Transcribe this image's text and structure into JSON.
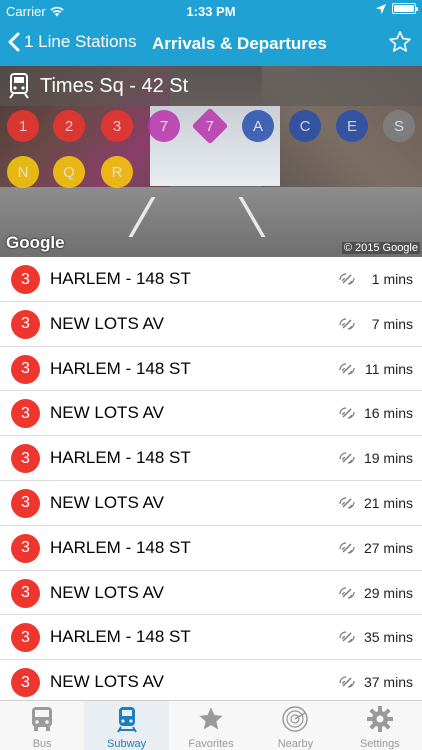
{
  "status_bar": {
    "carrier": "Carrier",
    "time": "1:33 PM"
  },
  "nav": {
    "back_label": "1 Line Stations",
    "title": "Arrivals & Departures"
  },
  "station": {
    "name": "Times Sq - 42 St"
  },
  "routes": [
    {
      "label": "1",
      "color": "#ee352e",
      "shape": "circle"
    },
    {
      "label": "2",
      "color": "#ee352e",
      "shape": "circle"
    },
    {
      "label": "3",
      "color": "#ee352e",
      "shape": "circle"
    },
    {
      "label": "7",
      "color": "#b933ad",
      "shape": "circle"
    },
    {
      "label": "7",
      "color": "#b933ad",
      "shape": "diamond"
    },
    {
      "label": "A",
      "color": "#2850ad",
      "shape": "circle"
    },
    {
      "label": "C",
      "color": "#2850ad",
      "shape": "circle"
    },
    {
      "label": "E",
      "color": "#2850ad",
      "shape": "circle"
    },
    {
      "label": "S",
      "color": "#808183",
      "shape": "circle"
    },
    {
      "label": "N",
      "color": "#fccc0a",
      "shape": "circle"
    },
    {
      "label": "Q",
      "color": "#fccc0a",
      "shape": "circle"
    },
    {
      "label": "R",
      "color": "#fccc0a",
      "shape": "circle"
    }
  ],
  "map": {
    "logo": "Google",
    "copyright": "© 2015 Google"
  },
  "arrivals": [
    {
      "route": "3",
      "destination": "HARLEM - 148 ST",
      "time": "1 mins"
    },
    {
      "route": "3",
      "destination": "NEW LOTS AV",
      "time": "7 mins"
    },
    {
      "route": "3",
      "destination": "HARLEM - 148 ST",
      "time": "11 mins"
    },
    {
      "route": "3",
      "destination": "NEW LOTS AV",
      "time": "16 mins"
    },
    {
      "route": "3",
      "destination": "HARLEM - 148 ST",
      "time": "19 mins"
    },
    {
      "route": "3",
      "destination": "NEW LOTS AV",
      "time": "21 mins"
    },
    {
      "route": "3",
      "destination": "HARLEM - 148 ST",
      "time": "27 mins"
    },
    {
      "route": "3",
      "destination": "NEW LOTS AV",
      "time": "29 mins"
    },
    {
      "route": "3",
      "destination": "HARLEM - 148 ST",
      "time": "35 mins"
    },
    {
      "route": "3",
      "destination": "NEW LOTS AV",
      "time": "37 mins"
    }
  ],
  "tabs": [
    {
      "label": "Bus",
      "icon": "bus-icon",
      "active": false
    },
    {
      "label": "Subway",
      "icon": "subway-icon",
      "active": true
    },
    {
      "label": "Favorites",
      "icon": "star-icon",
      "active": false
    },
    {
      "label": "Nearby",
      "icon": "radar-icon",
      "active": false
    },
    {
      "label": "Settings",
      "icon": "gear-icon",
      "active": false
    }
  ],
  "colors": {
    "accent": "#1fa1d3",
    "tab_active": "#1c7fc1",
    "route_3": "#ee352e"
  }
}
